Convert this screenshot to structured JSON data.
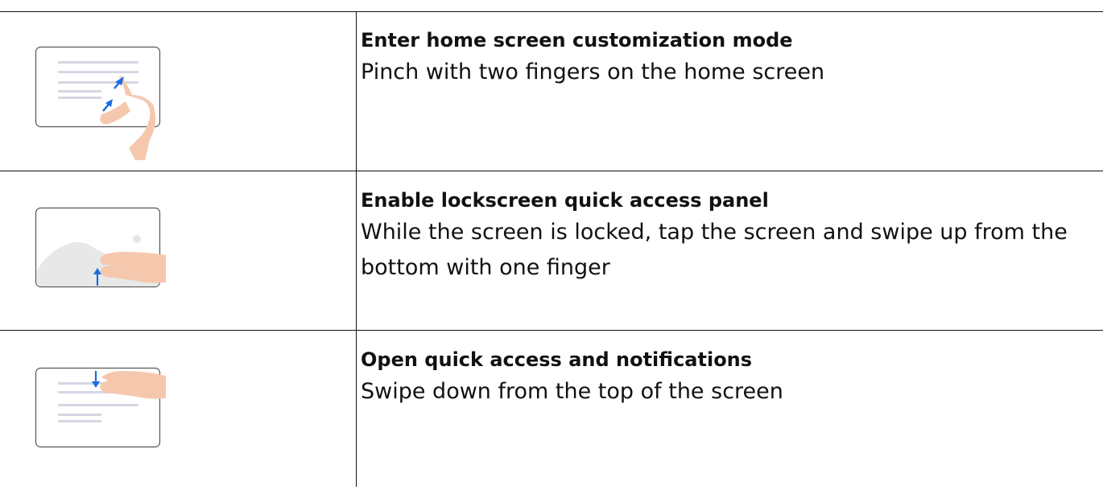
{
  "rows": [
    {
      "illustration": "pinch-gesture-icon",
      "title": "Enter home screen customization mode",
      "text": "Pinch with two fingers on the home screen"
    },
    {
      "illustration": "swipe-up-lockscreen-icon",
      "title": "Enable lockscreen quick access panel",
      "text": "While the screen is locked, tap the screen and swipe up from the bottom with one finger"
    },
    {
      "illustration": "swipe-down-top-icon",
      "title": "Open quick access and notifications",
      "text": "Swipe down from the top of the screen"
    }
  ],
  "colors": {
    "border": "#111111",
    "device_outline": "#555555",
    "content_lines": "#d6d6e6",
    "landscape": "#e8e8e8",
    "hand": "#f5c8ae",
    "arrow": "#1a6ce0"
  }
}
